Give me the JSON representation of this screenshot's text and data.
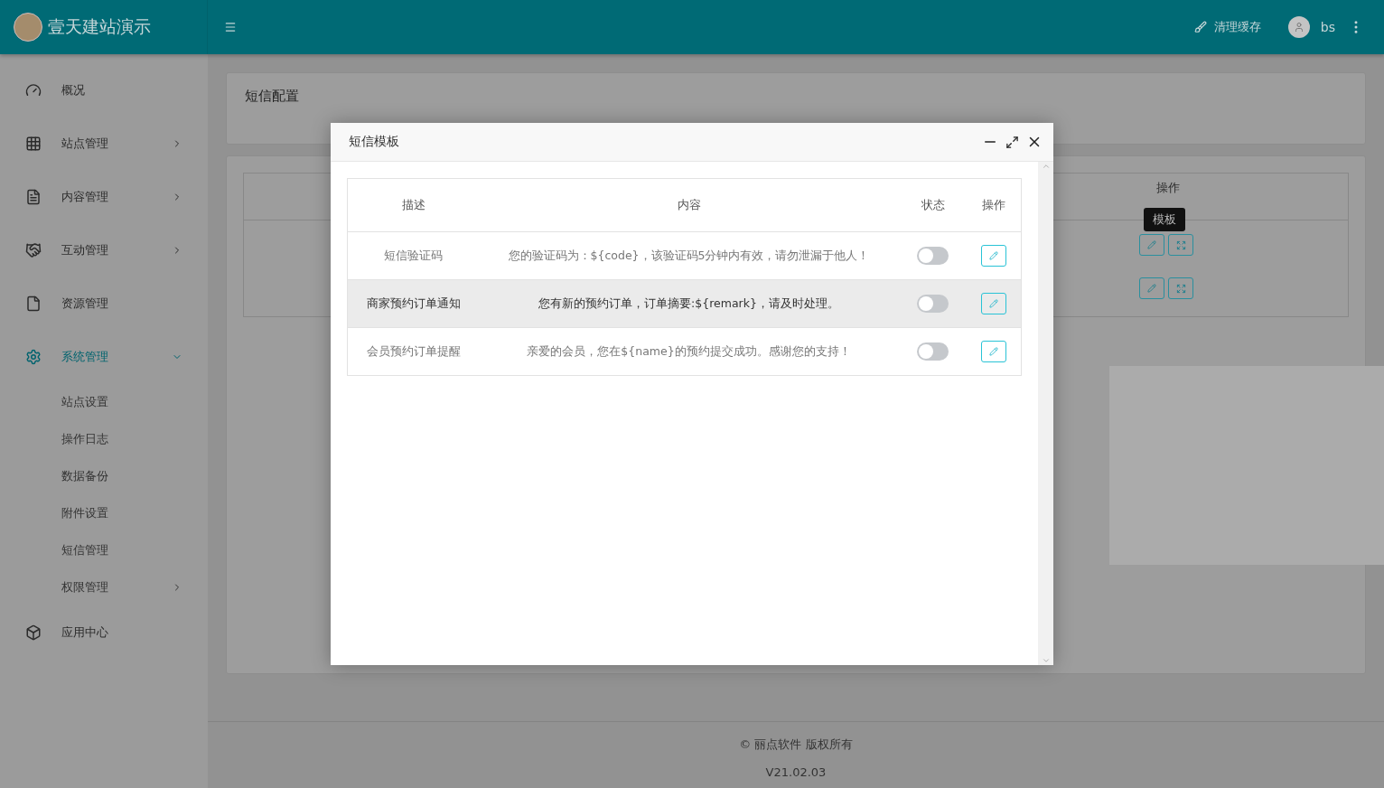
{
  "header": {
    "title": "壹天建站演示",
    "clear_cache": "清理缓存",
    "user": "bs"
  },
  "sidebar": {
    "items": [
      {
        "label": "概况",
        "expandable": false,
        "selected": false
      },
      {
        "label": "站点管理",
        "expandable": true,
        "expanded": false,
        "selected": false
      },
      {
        "label": "内容管理",
        "expandable": true,
        "expanded": false,
        "selected": false
      },
      {
        "label": "互动管理",
        "expandable": true,
        "expanded": false,
        "selected": false
      },
      {
        "label": "资源管理",
        "expandable": false,
        "selected": false
      },
      {
        "label": "系统管理",
        "expandable": true,
        "expanded": true,
        "selected": true,
        "children": [
          {
            "label": "站点设置",
            "expandable": false
          },
          {
            "label": "操作日志",
            "expandable": false
          },
          {
            "label": "数据备份",
            "expandable": false
          },
          {
            "label": "附件设置",
            "expandable": false
          },
          {
            "label": "短信管理",
            "expandable": false
          },
          {
            "label": "权限管理",
            "expandable": true
          }
        ]
      },
      {
        "label": "应用中心",
        "expandable": false,
        "selected": false
      }
    ]
  },
  "page": {
    "title": "短信配置",
    "table": {
      "column_header": "操作",
      "tooltip": "模板"
    }
  },
  "modal": {
    "title": "短信模板",
    "columns": [
      "描述",
      "内容",
      "状态",
      "操作"
    ],
    "rows": [
      {
        "description": "短信验证码",
        "content": "您的验证码为：${code}，该验证码5分钟内有效，请勿泄漏于他人！",
        "on": false,
        "highlighted": false
      },
      {
        "description": "商家预约订单通知",
        "content": "您有新的预约订单，订单摘要:${remark}，请及时处理。",
        "on": false,
        "highlighted": true
      },
      {
        "description": "会员预约订单提醒",
        "content": "亲爱的会员，您在${name}的预约提交成功。感谢您的支持！",
        "on": false,
        "highlighted": false
      }
    ]
  },
  "footer": {
    "copyright": "© 丽点软件 版权所有",
    "version": "V21.02.03"
  }
}
